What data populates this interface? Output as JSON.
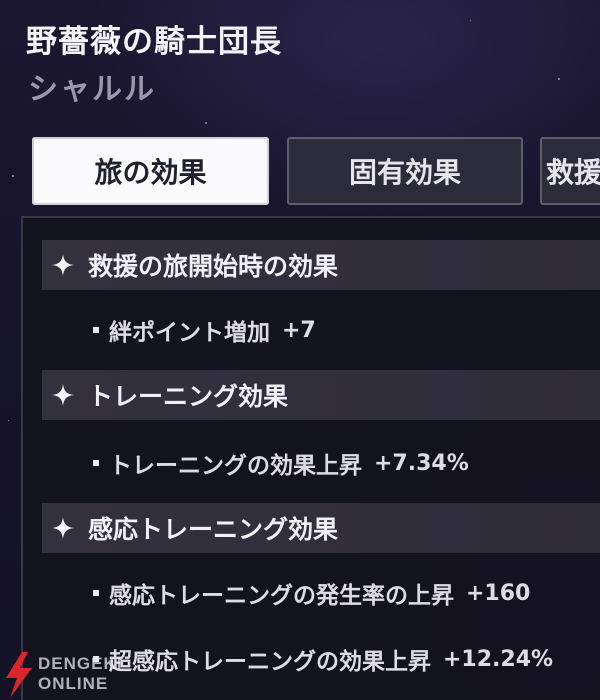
{
  "header": {
    "title": "野薔薇の騎士団長",
    "character_name": "シャルル"
  },
  "tabs": [
    {
      "label": "旅の効果",
      "active": true
    },
    {
      "label": "固有効果",
      "active": false
    },
    {
      "label": "救援",
      "active": false
    }
  ],
  "sections": [
    {
      "title": "救援の旅開始時の効果",
      "items": [
        {
          "label": "絆ポイント増加",
          "value": "+7"
        }
      ]
    },
    {
      "title": "トレーニング効果",
      "items": [
        {
          "label": "トレーニングの効果上昇",
          "value": "+7.34%"
        }
      ]
    },
    {
      "title": "感応トレーニング効果",
      "items": [
        {
          "label": "感応トレーニングの発生率の上昇",
          "value": "+160"
        },
        {
          "label": "超感応トレーニングの効果上昇",
          "value": "+12.24%"
        }
      ]
    }
  ],
  "watermark": {
    "line1": "DENGEKI",
    "line2": "ONLINE"
  },
  "colors": {
    "background": "#17142a",
    "tab_active": "#fbfbfd",
    "tab_inactive": "#2c2b39",
    "section_header": "#34313f",
    "watermark_red": "#d8262c"
  }
}
